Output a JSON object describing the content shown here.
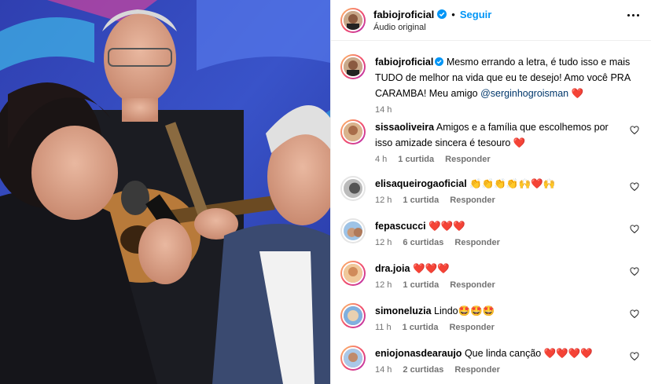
{
  "post": {
    "author": "fabiojroficial",
    "follow_label": "Seguir",
    "audio_label": "Áudio original",
    "caption_part1": "Mesmo errando a letra, é tudo isso e mais TUDO de melhor na vida que eu te desejo! Amo você PRA CARAMBA! Meu amigo ",
    "caption_mention": "@serginhogroisman",
    "caption_emoji": "❤️",
    "caption_time": "14 h"
  },
  "comments": [
    {
      "user": "sissaoliveira",
      "text": "Amigos e a família que escolhemos por isso amizade sincera é tesouro ",
      "emoji": "❤️",
      "time": "4 h",
      "likes": "1 curtida",
      "reply": "Responder"
    },
    {
      "user": "elisaqueirogaoficial",
      "text": "",
      "emoji": "👏👏👏👏🙌❤️🙌",
      "time": "12 h",
      "likes": "1 curtida",
      "reply": "Responder"
    },
    {
      "user": "fepascucci",
      "text": "",
      "emoji": "❤️❤️❤️",
      "time": "12 h",
      "likes": "6 curtidas",
      "reply": "Responder"
    },
    {
      "user": "dra.joia",
      "text": "",
      "emoji": "❤️❤️❤️",
      "time": "12 h",
      "likes": "1 curtida",
      "reply": "Responder"
    },
    {
      "user": "simoneluzia",
      "text": "Lindo",
      "emoji": "🤩🤩🤩",
      "time": "11 h",
      "likes": "1 curtida",
      "reply": "Responder"
    },
    {
      "user": "eniojonasdearaujo",
      "text": "Que linda canção ",
      "emoji": "❤️❤️❤️❤️",
      "time": "14 h",
      "likes": "2 curtidas",
      "reply": "Responder"
    }
  ],
  "icons": {
    "verified": "verified-badge-icon",
    "more": "more-options-icon",
    "like": "heart-outline-icon"
  },
  "colors": {
    "accent": "#0095f6",
    "verified": "#0095f6",
    "heart": "#ed1c24",
    "muted": "#737373"
  }
}
